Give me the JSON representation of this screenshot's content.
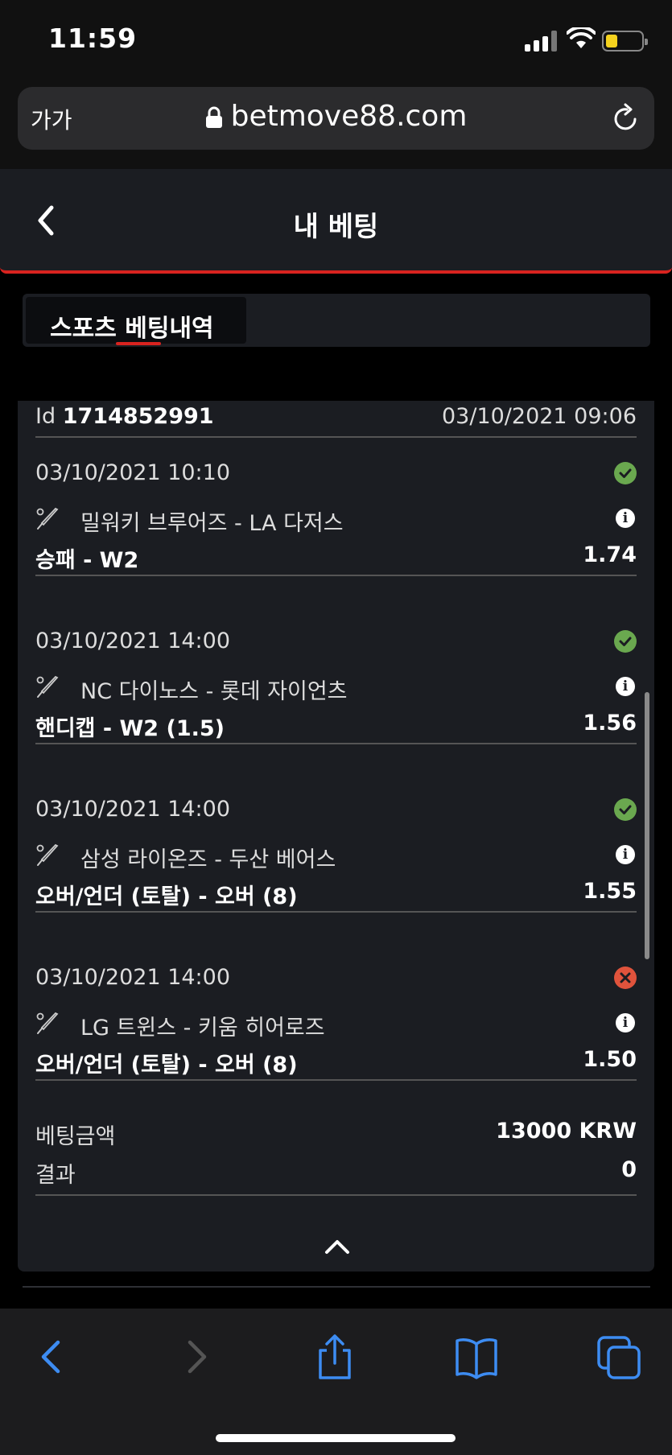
{
  "status_bar": {
    "time": "11:59"
  },
  "browser": {
    "text_size_label": "가가",
    "host": "betmove88.com"
  },
  "header": {
    "title": "내 베팅"
  },
  "tabs": [
    {
      "label": "스포츠 베팅내역",
      "active": true
    }
  ],
  "bet": {
    "id_prefix": "Id",
    "id": "1714852991",
    "placed_at": "03/10/2021 09:06",
    "selections": [
      {
        "datetime": "03/10/2021 10:10",
        "status": "won",
        "match": "밀워키 브루어즈 - LA 다저스",
        "market": "승패 - W2",
        "odds": "1.74"
      },
      {
        "datetime": "03/10/2021 14:00",
        "status": "won",
        "match": "NC 다이노스 - 롯데 자이언츠",
        "market": "핸디캡 - W2 (1.5)",
        "odds": "1.56"
      },
      {
        "datetime": "03/10/2021 14:00",
        "status": "won",
        "match": "삼성 라이온즈 - 두산 베어스",
        "market": "오버/언더 (토탈) - 오버 (8)",
        "odds": "1.55"
      },
      {
        "datetime": "03/10/2021 14:00",
        "status": "lost",
        "match": "LG 트윈스 - 키움 히어로즈",
        "market": "오버/언더 (토탈) - 오버 (8)",
        "odds": "1.50"
      }
    ],
    "stake_label": "베팅금액",
    "stake_value": "13000 KRW",
    "result_label": "결과",
    "result_value": "0"
  },
  "colors": {
    "accent": "#d8231f",
    "won": "#6aa84f",
    "lost": "#e0533c",
    "safari_blue": "#3d8cf2"
  }
}
